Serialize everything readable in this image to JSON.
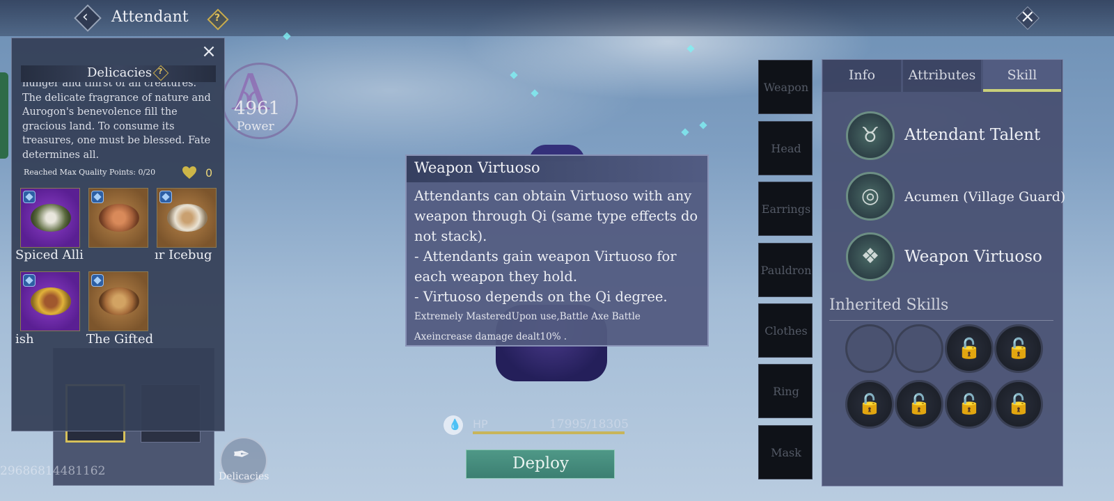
{
  "header": {
    "title": "Attendant"
  },
  "delicacies_panel": {
    "title": "Delicacies",
    "description": "hunger and thirst of all creatures. The delicate fragrance of nature and Aurogon's benevolence fill the gracious land. To consume its treasures, one must be blessed. Fate determines all.",
    "quality_text": "Reached Max Quality Points: 0/20",
    "heart_count": "0",
    "foods": [
      {
        "label": "Spiced Allig",
        "quality": "purple"
      },
      {
        "label": "",
        "quality": "gold"
      },
      {
        "label": "ır Icebug",
        "quality": "gold"
      },
      {
        "label": "ish",
        "quality": "purple"
      },
      {
        "label": "The Gifted",
        "quality": "gold"
      }
    ]
  },
  "uid": "29686814481162",
  "power": {
    "value": "4961",
    "label": "Power"
  },
  "tooltip": {
    "title": "Weapon Virtuoso",
    "body": "Attendants can obtain Virtuoso with any weapon through Qi (same type effects do not stack).\n- Attendants gain weapon Virtuoso for each weapon they hold.\n- Virtuoso depends on the Qi degree.",
    "small": "Extremely MasteredUpon use,Battle Axe Battle Axeincrease damage dealt10% ."
  },
  "hp": {
    "label": "HP",
    "value": "17995/18305"
  },
  "deploy_label": "Deploy",
  "delicacies_button_label": "Delicacies",
  "equipment_slots": [
    "Weapon",
    "Head",
    "Earrings",
    "Pauldron",
    "Clothes",
    "Ring",
    "Mask"
  ],
  "tabs": [
    {
      "label": "Info",
      "active": false
    },
    {
      "label": "Attributes",
      "active": false
    },
    {
      "label": "Skill",
      "active": true
    }
  ],
  "skills": [
    {
      "name": "Attendant Talent",
      "icon": "talent-icon"
    },
    {
      "name": "Acumen (Village Guard)",
      "icon": "acumen-icon"
    },
    {
      "name": "Weapon Virtuoso",
      "icon": "virtuoso-icon"
    }
  ],
  "inherited_skills": {
    "title": "Inherited Skills",
    "slots": [
      "empty",
      "empty",
      "locked",
      "locked",
      "locked",
      "locked",
      "locked",
      "locked"
    ]
  },
  "colors": {
    "accent": "#c9d07a",
    "deploy": "#4f9887",
    "gold": "#e3c460"
  }
}
